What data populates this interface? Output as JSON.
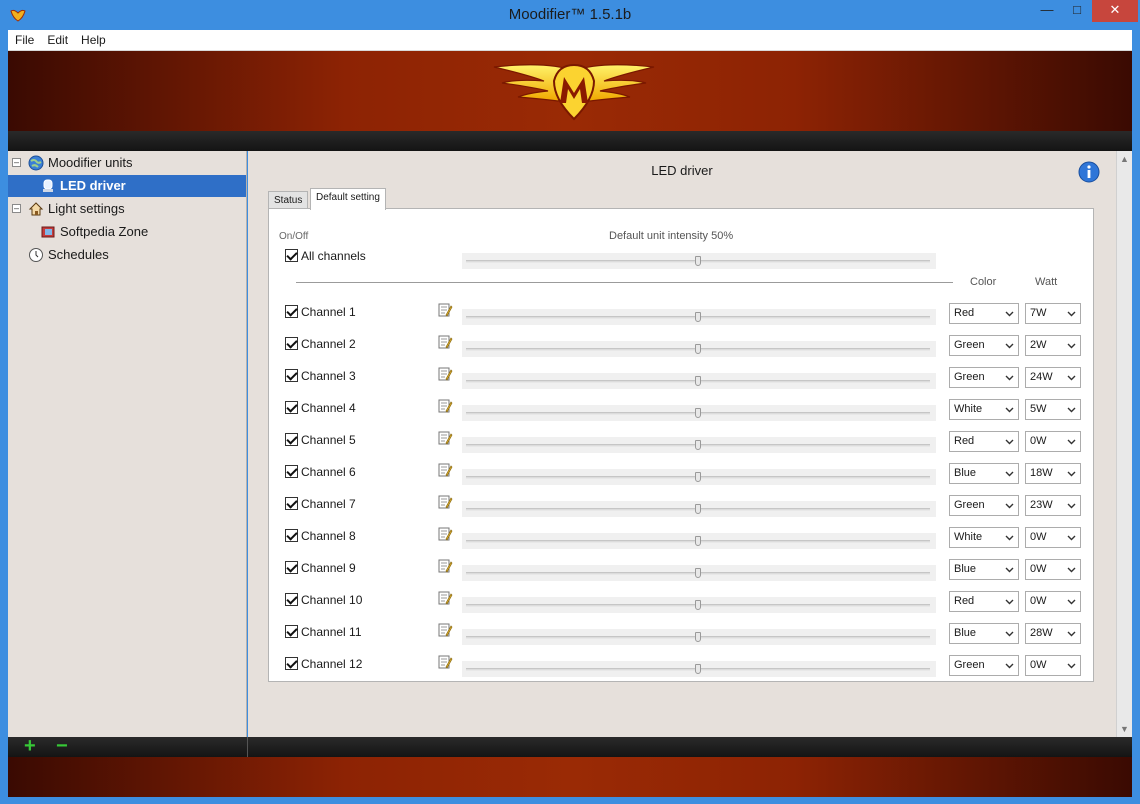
{
  "window": {
    "title": "Moodifier™ 1.5.1b"
  },
  "menu": [
    "File",
    "Edit",
    "Help"
  ],
  "tree": {
    "units_label": "Moodifier units",
    "led_driver_label": "LED driver",
    "light_settings_label": "Light settings",
    "softpedia_zone_label": "Softpedia Zone",
    "schedules_label": "Schedules"
  },
  "main": {
    "title": "LED driver",
    "tabs": [
      {
        "label": "Status",
        "active": false
      },
      {
        "label": "Default setting",
        "active": true
      }
    ],
    "on_off_label": "On/Off",
    "intensity_label": "Default unit intensity 50%",
    "all_channels_label": "All channels",
    "all_channels_checked": true,
    "intensity_value": 50,
    "color_header": "Color",
    "watt_header": "Watt",
    "channels": [
      {
        "label": "Channel 1",
        "checked": true,
        "color": "Red",
        "watt": "7W",
        "level": 50
      },
      {
        "label": "Channel 2",
        "checked": true,
        "color": "Green",
        "watt": "2W",
        "level": 50
      },
      {
        "label": "Channel 3",
        "checked": true,
        "color": "Green",
        "watt": "24W",
        "level": 50
      },
      {
        "label": "Channel 4",
        "checked": true,
        "color": "White",
        "watt": "5W",
        "level": 50
      },
      {
        "label": "Channel 5",
        "checked": true,
        "color": "Red",
        "watt": "0W",
        "level": 50
      },
      {
        "label": "Channel 6",
        "checked": true,
        "color": "Blue",
        "watt": "18W",
        "level": 50
      },
      {
        "label": "Channel 7",
        "checked": true,
        "color": "Green",
        "watt": "23W",
        "level": 50
      },
      {
        "label": "Channel 8",
        "checked": true,
        "color": "White",
        "watt": "0W",
        "level": 50
      },
      {
        "label": "Channel 9",
        "checked": true,
        "color": "Blue",
        "watt": "0W",
        "level": 50
      },
      {
        "label": "Channel 10",
        "checked": true,
        "color": "Red",
        "watt": "0W",
        "level": 50
      },
      {
        "label": "Channel 11",
        "checked": true,
        "color": "Blue",
        "watt": "28W",
        "level": 50
      },
      {
        "label": "Channel 12",
        "checked": true,
        "color": "Green",
        "watt": "0W",
        "level": 50
      }
    ]
  },
  "bottom": {
    "add_label": "+",
    "remove_label": "−"
  },
  "colors": {
    "accent": "#2f6fc7",
    "banner": "#8d2304",
    "add_green": "#37c837"
  }
}
